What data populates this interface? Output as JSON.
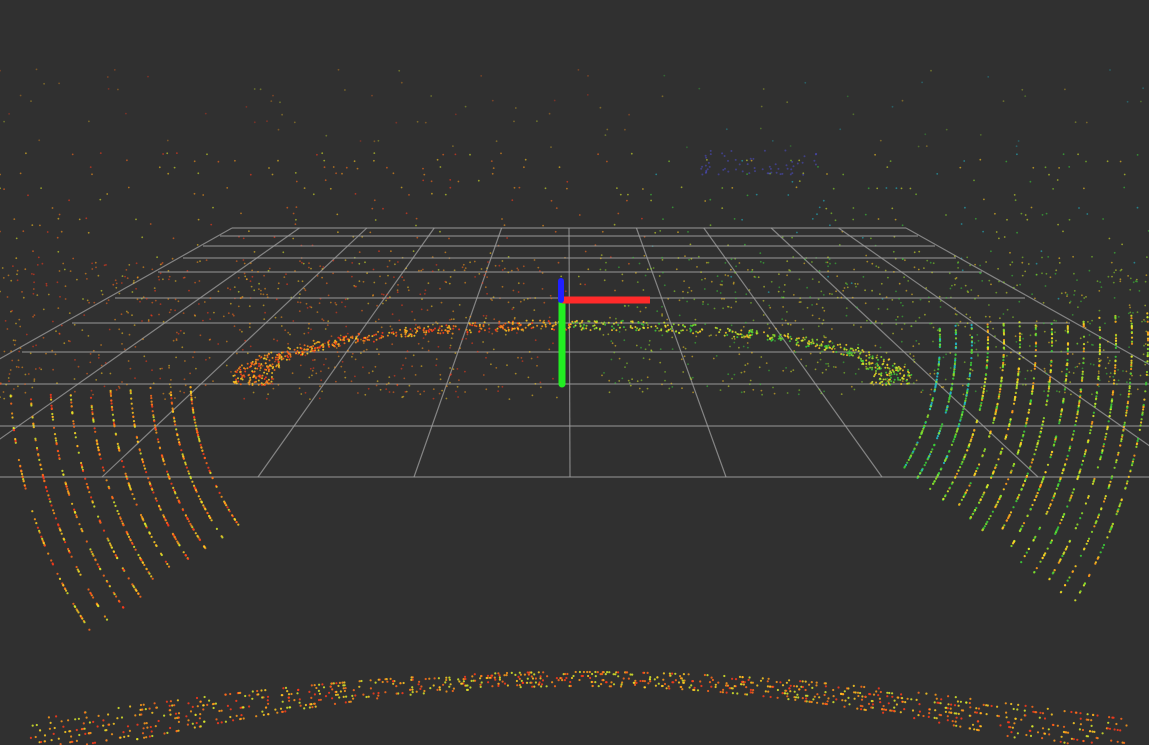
{
  "view": {
    "kind": "3d-pointcloud-viewer",
    "background_color": "#303030",
    "grid_color": "#a0a0a0"
  },
  "axes": {
    "x_color": "#ff2a2a",
    "y_color": "#22ee22",
    "z_color": "#2020ff"
  },
  "point_cloud": {
    "color_map": [
      "#ff3a1a",
      "#ff6a1a",
      "#ff9a1a",
      "#ffcc22",
      "#d8e82a",
      "#8cdc2a",
      "#3ccc38",
      "#22b8c8",
      "#5050d8"
    ]
  }
}
